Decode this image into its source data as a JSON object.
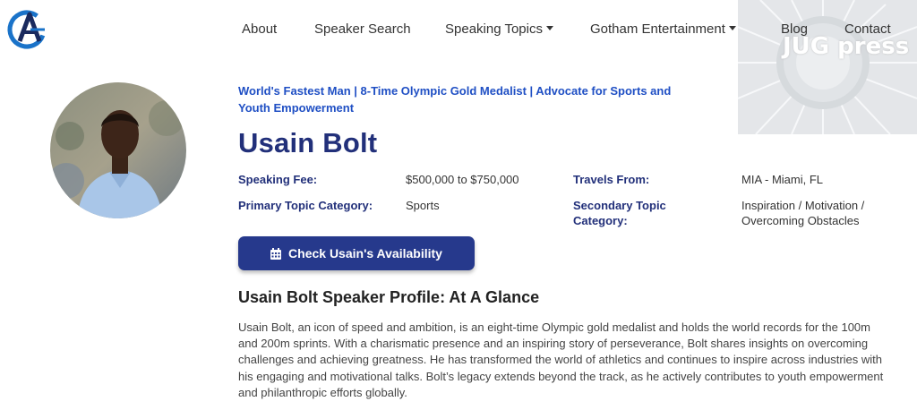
{
  "nav": {
    "items": [
      {
        "label": "About"
      },
      {
        "label": "Speaker Search"
      },
      {
        "label": "Speaking Topics",
        "dropdown": true
      },
      {
        "label": "Gotham Entertainment",
        "dropdown": true
      },
      {
        "label": "Blog"
      },
      {
        "label": "Contact"
      }
    ]
  },
  "watermark": {
    "text": "JUG press"
  },
  "speaker": {
    "tagline": "World's Fastest Man | 8-Time Olympic Gold Medalist | Advocate for Sports and Youth Empowerment",
    "name": "Usain Bolt"
  },
  "details": {
    "speaking_fee_label": "Speaking Fee:",
    "speaking_fee_value": "$500,000 to $750,000",
    "travels_from_label": "Travels From:",
    "travels_from_value": "MIA - Miami, FL",
    "primary_topic_label": "Primary Topic Category:",
    "primary_topic_value": "Sports",
    "secondary_topic_label": "Secondary Topic Category:",
    "secondary_topic_value": "Inspiration / Motivation / Overcoming Obstacles"
  },
  "cta": {
    "label": "Check Usain's Availability",
    "icon": "calendar-icon"
  },
  "profile": {
    "title": "Usain Bolt Speaker Profile: At A Glance",
    "bio": "Usain Bolt, an icon of speed and ambition, is an eight-time Olympic gold medalist and holds the world records for the 100m and 200m sprints. With a charismatic presence and an inspiring story of perseverance, Bolt shares insights on overcoming challenges and achieving greatness. He has transformed the world of athletics and continues to inspire across industries with his engaging and motivational talks. Bolt’s legacy extends beyond the track, as he actively contributes to youth empowerment and philanthropic efforts globally."
  },
  "colors": {
    "brand_navy": "#22307a",
    "tagline_blue": "#1f4fc4",
    "button_bg": "#26398c"
  }
}
